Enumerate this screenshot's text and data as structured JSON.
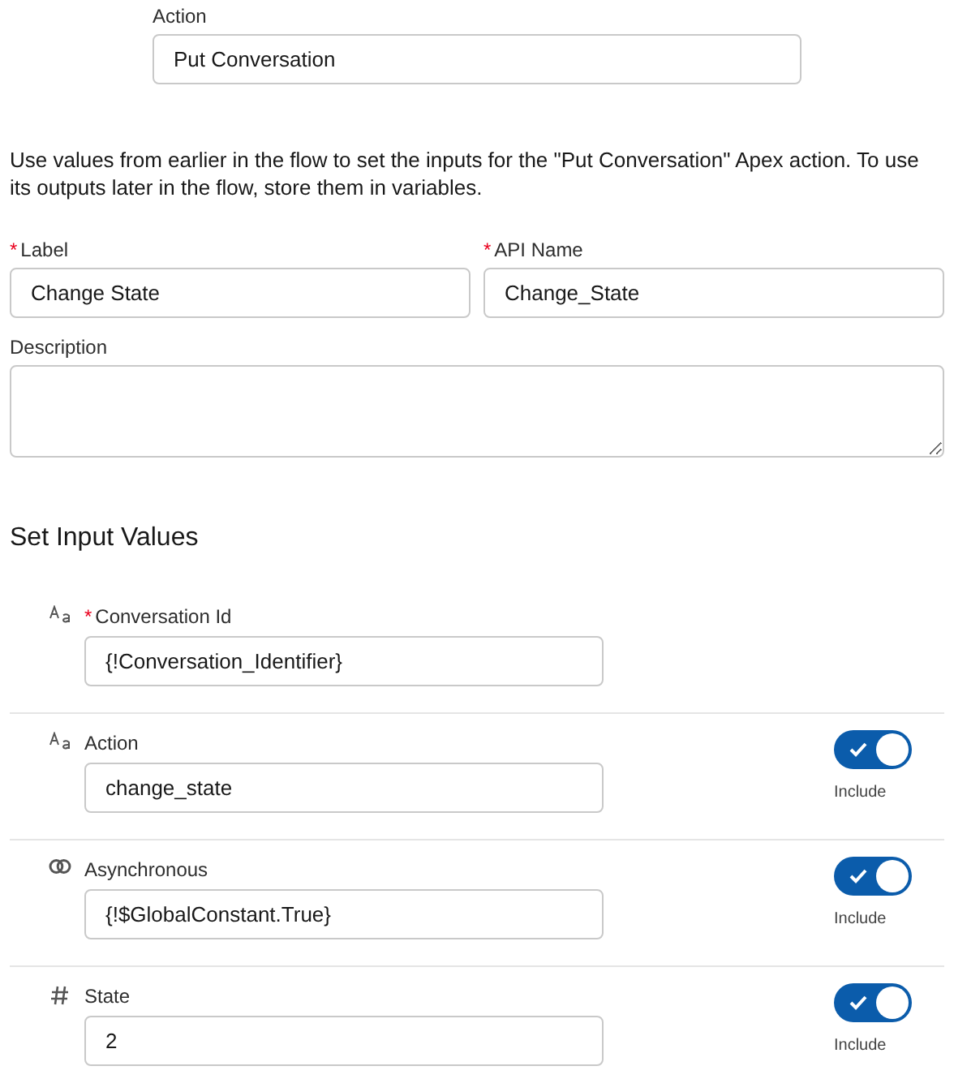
{
  "action": {
    "label": "Action",
    "value": "Put Conversation"
  },
  "description_text": "Use values from earlier in the flow to set the inputs for the \"Put Conversation\" Apex action. To use its outputs later in the flow, store them in variables.",
  "fields": [
    {
      "label": "Label",
      "required": true,
      "required_mark": "*",
      "value": "Change State"
    },
    {
      "label": "API Name",
      "required": true,
      "required_mark": "*",
      "value": "Change_State"
    }
  ],
  "description": {
    "label": "Description"
  },
  "section_title": "Set Input Values",
  "inputs": [
    {
      "kind": "text",
      "label": "Conversation Id",
      "required": true,
      "required_mark": "*",
      "value": "{!Conversation_Identifier}"
    },
    {
      "kind": "text",
      "label": "Action",
      "required": false,
      "value": "change_state",
      "include": {
        "on": true,
        "label": "Include"
      }
    },
    {
      "kind": "boolean",
      "label": "Asynchronous",
      "required": false,
      "value": "{!$GlobalConstant.True}",
      "include": {
        "on": true,
        "label": "Include"
      }
    },
    {
      "kind": "number",
      "label": "State",
      "required": false,
      "value": "2",
      "include": {
        "on": true,
        "label": "Include"
      }
    }
  ]
}
